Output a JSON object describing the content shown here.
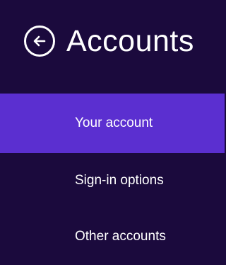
{
  "header": {
    "title": "Accounts",
    "back_icon": "back-arrow-circle-icon"
  },
  "nav": {
    "items": [
      {
        "label": "Your account",
        "selected": true
      },
      {
        "label": "Sign-in options",
        "selected": false
      },
      {
        "label": "Other accounts",
        "selected": false
      }
    ]
  },
  "colors": {
    "background": "#1b0a3d",
    "selected": "#5b2fd0",
    "text": "#ffffff"
  }
}
